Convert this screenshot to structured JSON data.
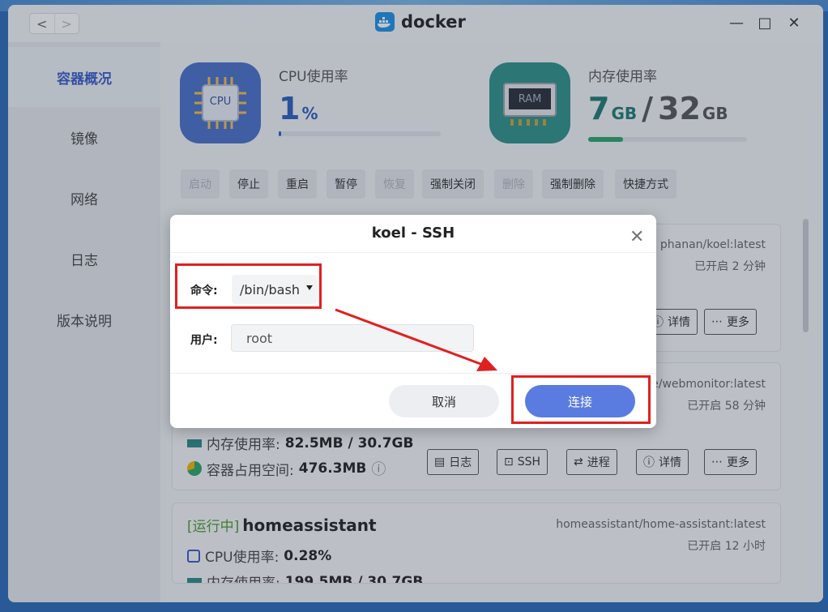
{
  "titlebar": {
    "app_name": "docker",
    "back": "<",
    "forward": ">",
    "minimize": "—",
    "maximize": "□",
    "close": "✕"
  },
  "sidebar": {
    "items": [
      {
        "label": "容器概况",
        "active": true
      },
      {
        "label": "镜像"
      },
      {
        "label": "网络"
      },
      {
        "label": "日志"
      },
      {
        "label": "版本说明"
      }
    ]
  },
  "stats": {
    "cpu": {
      "icon_text": "CPU",
      "label": "CPU使用率",
      "value": "1",
      "unit": "%",
      "progress": 0.01
    },
    "ram": {
      "icon_text": "RAM",
      "label": "内存使用率",
      "used": "7",
      "used_unit": "GB",
      "sep": "/",
      "total": "32",
      "total_unit": "GB",
      "progress": 0.22
    }
  },
  "toolbar": [
    {
      "label": "启动",
      "disabled": true
    },
    {
      "label": "停止"
    },
    {
      "label": "重启"
    },
    {
      "label": "暂停"
    },
    {
      "label": "恢复",
      "disabled": true
    },
    {
      "label": "强制关闭"
    },
    {
      "label": "删除",
      "disabled": true
    },
    {
      "label": "强制删除"
    },
    {
      "label": "快捷方式"
    }
  ],
  "cards": {
    "c1": {
      "image": "phanan/koel:latest",
      "uptime": "已开启 2 分钟",
      "details": "详情",
      "more": "更多"
    },
    "c2": {
      "image": "e/webmonitor:latest",
      "uptime": "已开启 58 分钟",
      "mem_label": "内存使用率:",
      "mem_value": "82.5MB / 30.7GB",
      "disk_label": "容器占用空间:",
      "disk_value": "476.3MB",
      "logs": "日志",
      "ssh": "SSH",
      "process": "进程",
      "details": "详情",
      "more": "更多"
    },
    "c3": {
      "status": "[运行中]",
      "name": "homeassistant",
      "image": "homeassistant/home-assistant:latest",
      "uptime": "已开启 12 小时",
      "cpu_label": "CPU使用率:",
      "cpu_value": "0.28%",
      "mem_label": "内存使用率:",
      "mem_value": "199.5MB / 30.7GB"
    }
  },
  "dialog": {
    "title": "koel - SSH",
    "command_label": "命令:",
    "command_value": "/bin/bash",
    "user_label": "用户:",
    "user_value": "root",
    "cancel": "取消",
    "connect": "连接"
  },
  "colors": {
    "accent": "#5a7ce0",
    "annotation": "#e02020",
    "cpu": "#2c5fbe",
    "ram": "#1f7a72"
  }
}
